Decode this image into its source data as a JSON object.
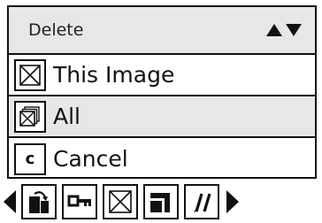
{
  "menu": {
    "title": "Delete",
    "items": [
      {
        "label": "This Image",
        "icon": "crossed-box-icon"
      },
      {
        "label": "All",
        "icon": "stacked-images-icon"
      },
      {
        "label": "Cancel",
        "icon_text": "c",
        "icon": "cancel-c-icon"
      }
    ]
  },
  "toolbar": {
    "icons": [
      "left-arrow-icon",
      "rotate-icon",
      "key-protect-icon",
      "delete-crossed-box-icon",
      "resize-icon",
      "edit-pen-icon",
      "right-arrow-icon"
    ]
  },
  "colors": {
    "header_bg": "#e6e7e8",
    "row_shaded": "#e6e7e8",
    "line": "#111111"
  }
}
